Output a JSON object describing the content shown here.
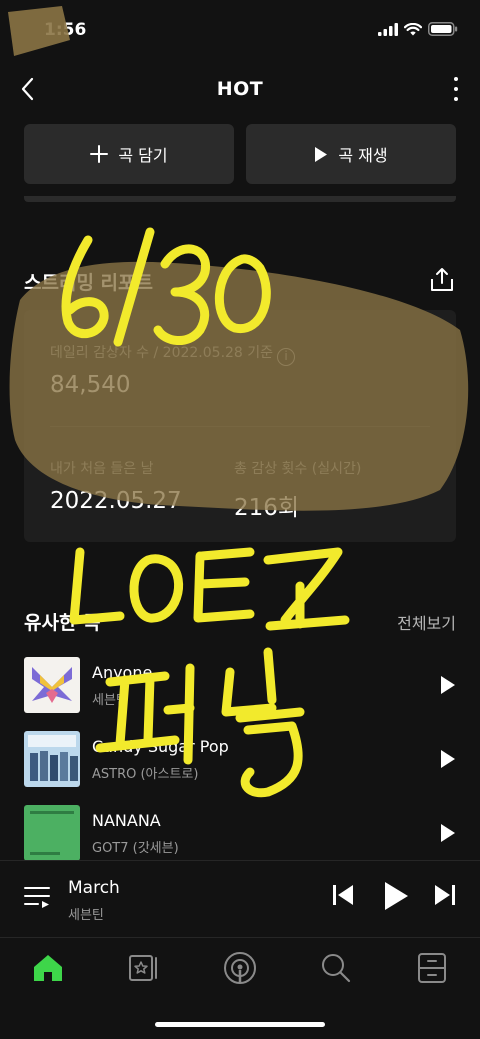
{
  "status": {
    "time": "1:56"
  },
  "nav": {
    "title": "HOT"
  },
  "actions": {
    "add_label": "곡 담기",
    "play_label": "곡 재생"
  },
  "streaming": {
    "title": "스트리밍 리포트",
    "daily_label": "데일리 감상자 수 / 2022.05.28 기준",
    "daily_value": "84,540",
    "first_listen_label": "내가 처음 들은 날",
    "first_listen_value": "2022.05.27",
    "total_plays_label": "총 감상 횟수 (실시간)",
    "total_plays_value": "216회"
  },
  "similar": {
    "title": "유사한 곡",
    "see_all": "전체보기",
    "songs": [
      {
        "title": "Anyone",
        "artist": "세븐틴"
      },
      {
        "title": "Candy Sugar Pop",
        "artist": "ASTRO (아스트로)"
      },
      {
        "title": "NANANA",
        "artist": "GOT7 (갓세븐)"
      }
    ]
  },
  "player": {
    "title": "March",
    "artist": "세븐틴"
  },
  "annotation": {
    "line1": "6/30",
    "line2": "LOEZ",
    "line3": "편든"
  },
  "colors": {
    "accent": "#3ed64a",
    "background": "#121212",
    "card": "#1e1e1e",
    "button": "#2b2b2b",
    "scribble": "#f2ea2c",
    "redaction": "#8b7445"
  }
}
